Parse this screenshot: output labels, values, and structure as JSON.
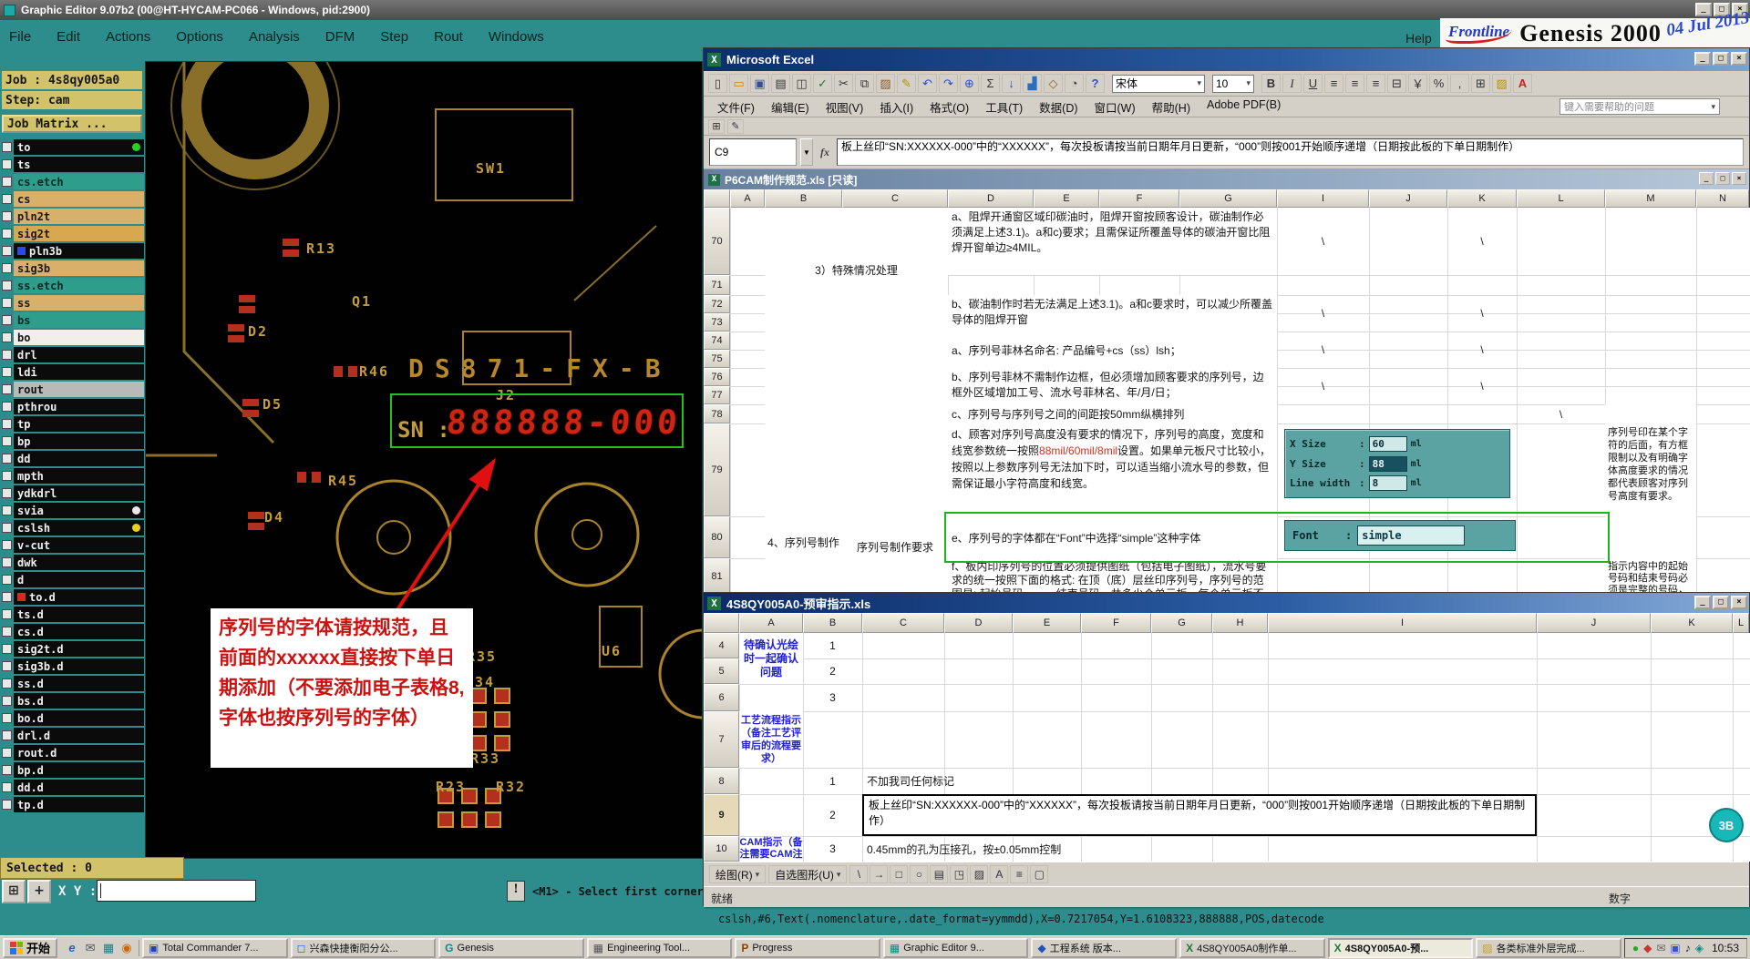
{
  "genesis": {
    "title": "Graphic Editor 9.07b2  (00@HT-HYCAM-PC066 - Windows, pid:2900)",
    "menu": [
      "File",
      "Edit",
      "Actions",
      "Options",
      "Analysis",
      "DFM",
      "Step",
      "Rout",
      "Windows"
    ],
    "help_label": "Help",
    "job_label": "Job : 4s8qy005a0",
    "step_label": "Step: cam",
    "matrix_label": "Job Matrix ...",
    "selected_label": "Selected : 0",
    "xy_label": "X Y :",
    "alert_glyph": "!",
    "status_hint": "<M1> - Select first corner",
    "command_line": "cslsh,#6,Text(.nomenclature,.date_format=yymmdd),X=0.7217054,Y=1.6108323,888888,POS,datecode",
    "floating_badge": "3B",
    "layers": [
      {
        "name": "to",
        "style": "background:#0b0b0b;color:#f0f0f0",
        "chipR": "display:inline-block;background:#22d422;border-radius:50%"
      },
      {
        "name": "ts",
        "style": "background:#0b0b0b;color:#f0f0f0"
      },
      {
        "name": "cs.etch",
        "style": "background:#2f9d8c;color:#062a24"
      },
      {
        "name": "cs",
        "style": "background:#d8b06a;color:#1a1a1a"
      },
      {
        "name": "pln2t",
        "style": "background:#d8b06a;color:#1a1a1a"
      },
      {
        "name": "sig2t",
        "style": "background:#d8a850;color:#1a1a1a"
      },
      {
        "name": "pln3b",
        "style": "background:#0b0b0b;color:#f0f0f0",
        "chipL": "display:inline-block;background:#2b48e8"
      },
      {
        "name": "sig3b",
        "style": "background:#d8b06a;color:#1a1a1a"
      },
      {
        "name": "ss.etch",
        "style": "background:#2f9d8c;color:#062a24"
      },
      {
        "name": "ss",
        "style": "background:#d8b06a;color:#1a1a1a"
      },
      {
        "name": "bs",
        "style": "background:#2f9d8c;color:#062a24"
      },
      {
        "name": "bo",
        "style": "background:#f0efe8;color:#141414"
      },
      {
        "name": "drl",
        "style": "background:#0b0b0b;color:#f0f0f0"
      },
      {
        "name": "ldi",
        "style": "background:#0b0b0b;color:#f0f0f0"
      },
      {
        "name": "rout",
        "style": "background:#b9b9b9;color:#141414"
      },
      {
        "name": "pthrou",
        "style": "background:#0b0b0b;color:#f0f0f0"
      },
      {
        "name": "tp",
        "style": "background:#0b0b0b;color:#f0f0f0"
      },
      {
        "name": "bp",
        "style": "background:#0b0b0b;color:#f0f0f0"
      },
      {
        "name": "dd",
        "style": "background:#0b0b0b;color:#f0f0f0"
      },
      {
        "name": "mpth",
        "style": "background:#0b0b0b;color:#f0f0f0"
      },
      {
        "name": "ydkdrl",
        "style": "background:#0b0b0b;color:#f0f0f0"
      },
      {
        "name": "svia",
        "style": "background:#0b0b0b;color:#f0f0f0",
        "chipR": "display:inline-block;background:#e8e8e8;border-radius:50%"
      },
      {
        "name": "cslsh",
        "style": "background:#0b0b0b;color:#f0f0f0",
        "chipR": "display:inline-block;background:#e8d022;border-radius:50%"
      },
      {
        "name": "v-cut",
        "style": "background:#0b0b0b;color:#f0f0f0"
      },
      {
        "name": "dwk",
        "style": "background:#0b0b0b;color:#f0f0f0"
      },
      {
        "name": "d",
        "style": "background:#0b0b0b;color:#f0f0f0"
      },
      {
        "name": "to.d",
        "style": "background:#0b0b0b;color:#f0f0f0",
        "chipL": "display:inline-block;background:#d82a1a"
      },
      {
        "name": "ts.d",
        "style": "background:#0b0b0b;color:#f0f0f0"
      },
      {
        "name": "cs.d",
        "style": "background:#0b0b0b;color:#f0f0f0"
      },
      {
        "name": "sig2t.d",
        "style": "background:#0b0b0b;color:#f0f0f0"
      },
      {
        "name": "sig3b.d",
        "style": "background:#0b0b0b;color:#f0f0f0"
      },
      {
        "name": "ss.d",
        "style": "background:#0b0b0b;color:#f0f0f0"
      },
      {
        "name": "bs.d",
        "style": "background:#0b0b0b;color:#f0f0f0"
      },
      {
        "name": "bo.d",
        "style": "background:#0b0b0b;color:#f0f0f0"
      },
      {
        "name": "drl.d",
        "style": "background:#0b0b0b;color:#f0f0f0"
      },
      {
        "name": "rout.d",
        "style": "background:#0b0b0b;color:#f0f0f0"
      },
      {
        "name": "bp.d",
        "style": "background:#0b0b0b;color:#f0f0f0"
      },
      {
        "name": "dd.d",
        "style": "background:#0b0b0b;color:#f0f0f0"
      },
      {
        "name": "tp.d",
        "style": "background:#0b0b0b;color:#f0f0f0"
      }
    ],
    "canvas": {
      "part_number": "DS871-FX-B",
      "sn_label": "SN :",
      "sn_digits": "888888-000",
      "annotation": "序列号的字体请按规范，且前面的xxxxxx直接按下单日期添加（不要添加电子表格8,字体也按序列号的字体）",
      "component_labels": [
        {
          "text": "SW1",
          "style": "left:362px;top:108px"
        },
        {
          "text": "R13",
          "style": "left:176px;top:196px"
        },
        {
          "text": "Q1",
          "style": "left:226px;top:254px"
        },
        {
          "text": "D2",
          "style": "left:112px;top:287px"
        },
        {
          "text": "R46",
          "style": "left:234px;top:331px"
        },
        {
          "text": "D5",
          "style": "left:128px;top:367px"
        },
        {
          "text": "J2",
          "style": "left:384px;top:357px"
        },
        {
          "text": "R45",
          "style": "left:200px;top:451px"
        },
        {
          "text": "D4",
          "style": "left:130px;top:491px"
        },
        {
          "text": "U6",
          "style": "left:500px;top:638px"
        },
        {
          "text": "R35",
          "style": "left:352px;top:644px"
        },
        {
          "text": "R34",
          "style": "left:350px;top:672px"
        },
        {
          "text": "R33",
          "style": "left:356px;top:756px"
        },
        {
          "text": "R23",
          "style": "left:318px;top:787px"
        },
        {
          "text": "R32",
          "style": "left:384px;top:787px"
        }
      ]
    }
  },
  "branding": {
    "frontline": "Frontline",
    "product": "Genesis 2000",
    "handwritten_date": "04 Jul 2013"
  },
  "excel_main": {
    "title": "Microsoft Excel",
    "menus": [
      "文件(F)",
      "编辑(E)",
      "视图(V)",
      "插入(I)",
      "格式(O)",
      "工具(T)",
      "数据(D)",
      "窗口(W)",
      "帮助(H)",
      "Adobe PDF(B)"
    ],
    "help_box": "键入需要帮助的问题",
    "toolbar_icons": [
      {
        "name": "new-icon",
        "glyph": "▯"
      },
      {
        "name": "open-icon",
        "glyph": "▭",
        "style": "color:#b89000"
      },
      {
        "name": "save-icon",
        "glyph": "▣",
        "style": "color:#334d99"
      },
      {
        "name": "print-icon",
        "glyph": "▤"
      },
      {
        "name": "print-preview-icon",
        "glyph": "◫"
      },
      {
        "name": "spelling-icon",
        "glyph": "✓",
        "style": "color:#1a7a3a"
      },
      {
        "name": "cut-icon",
        "glyph": "✂"
      },
      {
        "name": "copy-icon",
        "glyph": "⧉"
      },
      {
        "name": "paste-icon",
        "glyph": "▨",
        "style": "color:#8a5a2a"
      },
      {
        "name": "format-painter-icon",
        "glyph": "✎",
        "style": "color:#b89000"
      },
      {
        "name": "undo-icon",
        "glyph": "↶",
        "style": "color:#2a4fd0"
      },
      {
        "name": "redo-icon",
        "glyph": "↷",
        "style": "color:#2a4fd0"
      },
      {
        "name": "hyperlink-icon",
        "glyph": "⊕",
        "style": "color:#2a4fd0"
      },
      {
        "name": "autosum-icon",
        "glyph": "Σ"
      },
      {
        "name": "sort-ascending-icon",
        "glyph": "↓",
        "style": "color:#2a4fd0"
      },
      {
        "name": "chart-wizard-icon",
        "glyph": "▟",
        "style": "color:#2a6fbf"
      },
      {
        "name": "drawing-icon",
        "glyph": "◇",
        "style": "color:#8a5a2a"
      },
      {
        "name": "zoom-icon",
        "glyph": "◔"
      },
      {
        "name": "help-icon",
        "glyph": "?",
        "style": "color:#2a4fd0;font-weight:bold"
      }
    ],
    "font_name": "宋体",
    "font_size": "10",
    "format_icons": [
      {
        "name": "bold-button",
        "glyph": "B",
        "style": "font-weight:bold"
      },
      {
        "name": "italic-button",
        "glyph": "I",
        "style": "font-style:italic;font-family:'Liberation Serif',serif"
      },
      {
        "name": "underline-button",
        "glyph": "U",
        "style": "text-decoration:underline"
      },
      {
        "name": "align-left-icon",
        "glyph": "≡"
      },
      {
        "name": "align-center-icon",
        "glyph": "≡"
      },
      {
        "name": "align-right-icon",
        "glyph": "≡"
      },
      {
        "name": "merge-center-icon",
        "glyph": "⊟"
      },
      {
        "name": "currency-icon",
        "glyph": "￥"
      },
      {
        "name": "percent-icon",
        "glyph": "%"
      },
      {
        "name": "comma-icon",
        "glyph": ","
      },
      {
        "name": "borders-icon",
        "glyph": "⊞"
      },
      {
        "name": "fill-color-icon",
        "glyph": "▨",
        "style": "color:#b89000"
      },
      {
        "name": "font-color-icon",
        "glyph": "A",
        "style": "color:#cc2020;font-weight:bold"
      }
    ],
    "mini_icons": [
      {
        "name": "insert-table-icon",
        "glyph": "⊞"
      },
      {
        "name": "edit-cell-icon",
        "glyph": "✎"
      }
    ],
    "name_box": "C9",
    "fx_label": "fx",
    "formula": "板上丝印“SN:XXXXXX-000”中的“XXXXXX”，每次投板请按当前日期年月日更新，“000”则按001开始顺序递增（日期按此板的下单日期制作）",
    "doc_title": "P6CAM制作规范.xls  [只读]",
    "columns": [
      "A",
      "B",
      "C",
      "D",
      "E",
      "F",
      "G",
      "I",
      "J",
      "K",
      "L",
      "M",
      "N"
    ],
    "row_numbers": [
      "70",
      "71",
      "72",
      "73",
      "74",
      "75",
      "76",
      "77",
      "78",
      "79",
      "80",
      "81"
    ],
    "cells": {
      "section3": "3）特殊情况处理",
      "row70": "a、阻焊开通窗区域印碳油时，阻焊开窗按顾客设计，碳油制作必须满足上述3.1)。a和c)要求；且需保证所覆盖导体的碳油开窗比阻焊开窗单边≥4MIL。",
      "row72": "b、碳油制作时若无法满足上述3.1)。a和c要求时，可以减少所覆盖导体的阻焊开窗",
      "row74": "a、序列号菲林名命名: 产品编号+cs（ss）lsh；",
      "row76": "b、序列号菲林不需制作边框，但必须增加顾客要求的序列号，边框外区域增加工号、流水号菲林名、年/月/日；",
      "row78": "c、序列号与序列号之间的间距按50mm纵横排列",
      "row79_pre": "d、顾客对序列号高度没有要求的情况下，序列号的高度，宽度和线宽参数统一按照",
      "row79_red": "88mil/60mil/8mil",
      "row79_post": "设置。如果单元板尺寸比较小，按照以上参数序列号无法加下时，可以适当缩小流水号的参数，但需保证最小字符高度和线宽。",
      "row80": "e、序列号的字体都在“Font”中选择“simple”这种字体",
      "row81": "f、板内印序列号的位置必须提供图纸（包括电子图纸），流水号要求的统一按照下面的格式: 在顶（底）层丝印序列号，序列号的范围是: 起始号码～～～结束号码，共多少个单元板，每个单元板不可重复。",
      "note78": "序列号印在某个字符的后面，有方框限制以及有明确字体高度要求的情况都代表顾客对序列号高度有要求。",
      "note81": "指示内容中的起始号码和结束号码必须是完整的号码，不允许省略相同的部分，起始号码和结束号码之间需要采用长波浪线或者长横线，日期和起始号码分开并...",
      "section4_b": "4、序列号制作",
      "section4_c": "序列号制作要求",
      "slash": "\\"
    },
    "size_dialog": {
      "colon": ":",
      "rows": [
        {
          "label": "X Size",
          "value": "60",
          "unit": "ml",
          "vstyle": ""
        },
        {
          "label": "Y Size",
          "value": "88",
          "unit": "ml",
          "vstyle": "background:#17505e;color:#eaf8f8"
        },
        {
          "label": "Line width",
          "value": "8",
          "unit": "ml",
          "vstyle": ""
        }
      ]
    },
    "font_dialog": {
      "label": "Font",
      "colon": ":",
      "value": "simple"
    }
  },
  "excel_doc2": {
    "title": "4S8QY005A0-预审指示.xls",
    "columns": [
      "A",
      "B",
      "C",
      "D",
      "E",
      "F",
      "G",
      "H",
      "I",
      "J",
      "K",
      "L"
    ],
    "row_numbers": [
      "4",
      "5",
      "6",
      "7",
      "8",
      "9",
      "10"
    ],
    "cells": {
      "a4": "待确认光绘时一起确认问题",
      "b4": "1",
      "b5": "2",
      "b6": "3",
      "a7": "工艺流程指示（备注工艺评审后的流程要求）",
      "b8": "1",
      "c8": "不加我司任何标记",
      "b9": "2",
      "c9": "板上丝印“SN:XXXXXX-000”中的“XXXXXX”，每次投板请按当前日期年月日更新，“000”则按001开始顺序递增（日期按此板的下单日期制作）",
      "a10": "CAM指示（备注需要CAM注",
      "b10": "3",
      "c10": "0.45mm的孔为压接孔，按±0.05mm控制"
    },
    "drawing_label": "绘图(R)",
    "autoshapes_label": "自选图形(U)",
    "drawing_glyphs": [
      "\\",
      "→",
      "□",
      "○",
      "▤",
      "◳",
      "▨",
      "A",
      "≡",
      "▢"
    ],
    "status_ready": "就绪",
    "status_num": "数字"
  },
  "taskbar": {
    "start_label": "开始",
    "quick_launch": [
      {
        "name": "ie-icon",
        "glyph": "e",
        "style": "color:#1a66cc;font-style:italic;font-weight:bold"
      },
      {
        "name": "mail-icon",
        "glyph": "✉",
        "style": "color:#555555"
      },
      {
        "name": "show-desktop-icon",
        "glyph": "▦",
        "style": "color:#2a7a7a"
      },
      {
        "name": "media-player-icon",
        "glyph": "◉",
        "style": "color:#cc6600"
      }
    ],
    "tasks": [
      {
        "label": "Total Commander 7...",
        "glyph": "▣",
        "gstyle": "color:#2244aa",
        "style": ""
      },
      {
        "label": "兴森快捷衡阳分公...",
        "glyph": "◻",
        "gstyle": "color:#3366cc",
        "style": ""
      },
      {
        "label": "Genesis",
        "glyph": "G",
        "gstyle": "color:#0e8a8a;font-weight:bold",
        "style": ""
      },
      {
        "label": "Engineering Tool...",
        "glyph": "▦",
        "gstyle": "color:#555555",
        "style": ""
      },
      {
        "label": "Progress",
        "glyph": "P",
        "gstyle": "color:#884400;font-weight:bold",
        "style": ""
      },
      {
        "label": "Graphic Editor 9...",
        "glyph": "▦",
        "gstyle": "color:#0e8a8a",
        "style": ""
      },
      {
        "label": "工程系统  版本...",
        "glyph": "◆",
        "gstyle": "color:#2255bb",
        "style": ""
      },
      {
        "label": "4S8QY005A0制作单...",
        "glyph": "X",
        "gstyle": "color:#1a7a3a;font-weight:bold",
        "style": ""
      },
      {
        "label": "4S8QY005A0-预...",
        "glyph": "X",
        "gstyle": "color:#1a7a3a;font-weight:bold",
        "style": "background:#ece9dd;border-style:inset;font-weight:bold"
      },
      {
        "label": "各类标准外层完成...",
        "glyph": "▨",
        "gstyle": "color:#c8a020",
        "style": ""
      }
    ],
    "tray_icons": [
      {
        "name": "tray-icon-shield",
        "glyph": "●",
        "style": "color:#22aa22"
      },
      {
        "name": "tray-icon-alert",
        "glyph": "◆",
        "style": "color:#cc3333"
      },
      {
        "name": "tray-icon-mail",
        "glyph": "✉",
        "style": "color:#666666"
      },
      {
        "name": "tray-icon-network",
        "glyph": "▣",
        "style": "color:#3355cc"
      },
      {
        "name": "tray-icon-volume",
        "glyph": "♪",
        "style": "color:#222222"
      },
      {
        "name": "tray-icon-ime",
        "glyph": "◈",
        "style": "color:#0e8a8a"
      }
    ],
    "clock": "10:53"
  }
}
